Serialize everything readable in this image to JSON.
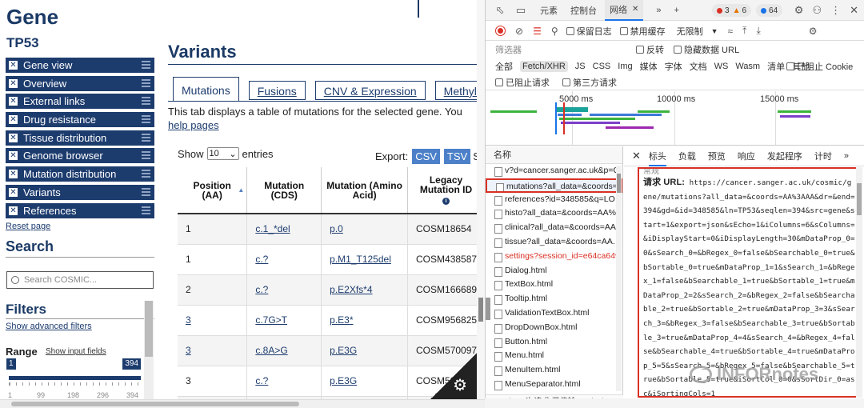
{
  "cosmic": {
    "gene_title": "Gene",
    "gene_symbol": "TP53",
    "nav": [
      {
        "label": "Gene view",
        "name": "nav-gene-view"
      },
      {
        "label": "Overview",
        "name": "nav-overview"
      },
      {
        "label": "External links",
        "name": "nav-external-links"
      },
      {
        "label": "Drug resistance",
        "name": "nav-drug-resistance"
      },
      {
        "label": "Tissue distribution",
        "name": "nav-tissue-distribution"
      },
      {
        "label": "Genome browser",
        "name": "nav-genome-browser"
      },
      {
        "label": "Mutation distribution",
        "name": "nav-mutation-distribution"
      },
      {
        "label": "Variants",
        "name": "nav-variants"
      },
      {
        "label": "References",
        "name": "nav-references"
      }
    ],
    "reports_link": "Reset page",
    "search_heading": "Search",
    "search_placeholder": "Search COSMIC...",
    "filters_heading": "Filters",
    "advanced_filters_link": "Show advanced filters",
    "range_heading": "Range",
    "range_show_fields": "Show input fields",
    "range_min": "1",
    "range_max": "394",
    "range_ticks": [
      "1",
      "99",
      "198",
      "296",
      "394"
    ],
    "variants_heading": "Variants",
    "tabs": [
      "Mutations",
      "Fusions",
      "CNV & Expression",
      "Methylat"
    ],
    "tab_description": "This tab displays a table of mutations for the selected gene. You",
    "help_link": "help pages",
    "show_label": "Show",
    "show_value": "10",
    "entries_label": "entries",
    "export_label": "Export:",
    "export_buttons": [
      "CSV",
      "TSV"
    ],
    "export_trailing": "S",
    "table": {
      "headers": [
        "Position (AA)",
        "Mutation (CDS)",
        "Mutation (Amino Acid)",
        "Legacy Mutation ID"
      ],
      "rows": [
        [
          "1",
          "c.1_*del",
          "p.0",
          "COSM18654"
        ],
        [
          "1",
          "c.?",
          "p.M1_T125del",
          "COSM438587"
        ],
        [
          "2",
          "c.?",
          "p.E2Xfs*4",
          "COSM166689"
        ],
        [
          "3",
          "c.7G>T",
          "p.E3*",
          "COSM956825"
        ],
        [
          "3",
          "c.8A>G",
          "p.E3G",
          "COSM570097"
        ],
        [
          "3",
          "c.?",
          "p.E3G",
          "COSM59"
        ],
        [
          "4",
          "c.11C>T",
          "p.P4L",
          "COSM"
        ]
      ],
      "position_links": [
        false,
        false,
        false,
        true,
        true,
        false,
        true
      ]
    }
  },
  "devtools": {
    "top_tabs": [
      "元素",
      "控制台",
      "网络"
    ],
    "badges": {
      "warnings": "3",
      "errors": "6",
      "issues": "64"
    },
    "toolbar": {
      "preserve_log": "保留日志",
      "disable_cache": "禁用缓存",
      "throttle": "无限制"
    },
    "filter_placeholder": "筛选器",
    "invert": "反转",
    "hide_data_urls": "隐藏数据 URL",
    "filter_types": [
      "全部",
      "Fetch/XHR",
      "JS",
      "CSS",
      "Img",
      "媒体",
      "字体",
      "文档",
      "WS",
      "Wasm",
      "清单",
      "其他"
    ],
    "block_cookies": "已阻止 Cookie",
    "blocked_requests": "已阻止请求",
    "third_party": "第三方请求",
    "timeline_labels": [
      "5000 ms",
      "10000 ms",
      "15000 ms"
    ],
    "name_header": "名称",
    "requests": [
      {
        "name": "v?d=cancer.sanger.ac.uk&p=C",
        "state": "normal"
      },
      {
        "name": "mutations?all_data=&coords=",
        "state": "selected"
      },
      {
        "name": "references?id=348585&q=LO",
        "state": "normal"
      },
      {
        "name": "histo?all_data=&coords=AA%",
        "state": "normal"
      },
      {
        "name": "clinical?all_data=&coords=AA",
        "state": "normal"
      },
      {
        "name": "tissue?all_data=&coords=AA.",
        "state": "normal"
      },
      {
        "name": "settings?session_id=e64ca649",
        "state": "error"
      },
      {
        "name": "Dialog.html",
        "state": "normal"
      },
      {
        "name": "TextBox.html",
        "state": "normal"
      },
      {
        "name": "Tooltip.html",
        "state": "normal"
      },
      {
        "name": "ValidationTextBox.html",
        "state": "normal"
      },
      {
        "name": "DropDownBox.html",
        "state": "normal"
      },
      {
        "name": "Button.html",
        "state": "normal"
      },
      {
        "name": "Menu.html",
        "state": "normal"
      },
      {
        "name": "MenuItem.html",
        "state": "normal"
      },
      {
        "name": "MenuSeparator.html",
        "state": "normal"
      }
    ],
    "status_bar": "37 /124 次请求 已传输108 kB/172",
    "detail_tabs": [
      "标头",
      "负载",
      "预览",
      "响应",
      "发起程序",
      "计时"
    ],
    "detail_cut_label": "常规",
    "request_url_label": "请求 URL:",
    "request_url": " https://cancer.sanger.ac.uk/cosmic/gene/mutations?all_data=&coords=AA%3AAA&dr=&end=394&gd=&id=348585&ln=TP53&seqlen=394&src=gene&start=1&export=json&sEcho=1&iColumns=6&sColumns=&iDisplayStart=0&iDisplayLength=30&mDataProp_0=0&sSearch_0=&bRegex_0=false&bSearchable_0=true&bSortable_0=true&mDataProp_1=1&sSearch_1=&bRegex_1=false&bSearchable_1=true&bSortable_1=true&mDataProp_2=2&sSearch_2=&bRegex_2=false&bSearchable_2=true&bSortable_2=true&mDataProp_3=3&sSearch_3=&bRegex_3=false&bSearchable_3=true&bSortable_3=true&mDataProp_4=4&sSearch_4=&bRegex_4=false&bSearchable_4=true&bSortable_4=true&mDataProp_5=5&sSearch_5=&bRegex_5=false&bSearchable_5=true&bSortable_5=true&iSortCol_0=0&sSortDir_0=asc&iSortingCols=1",
    "watermark": "INFORnotes"
  }
}
